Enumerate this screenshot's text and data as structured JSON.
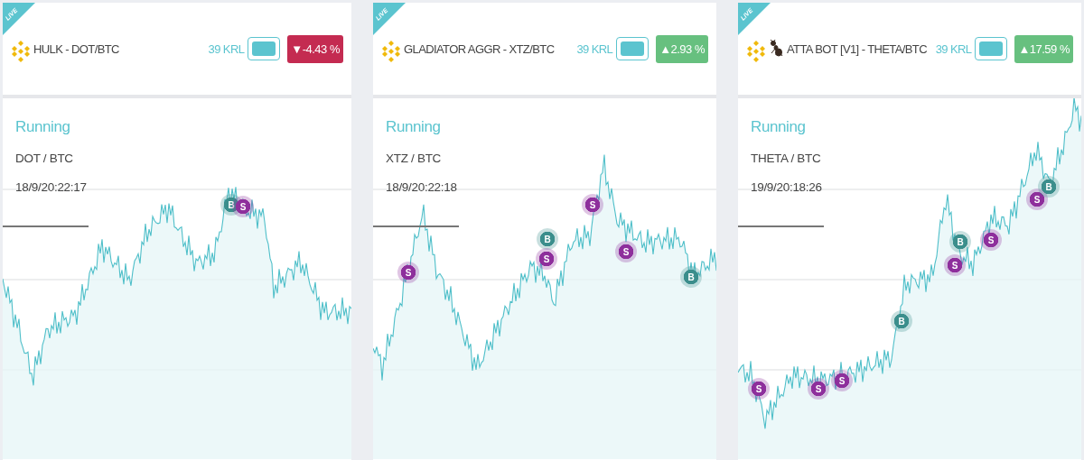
{
  "cards": [
    {
      "ribbon": "LIVE",
      "mascot": false,
      "title": "HULK - DOT/BTC",
      "price": "39 KRL",
      "toggle": {
        "on": true
      },
      "change": {
        "negative": true,
        "arrow": "▼",
        "value": "-4.43 %"
      },
      "status": "Running",
      "pair": "DOT / BTC",
      "started": "18/9/20:22:17",
      "markers": [
        {
          "kind": "buy",
          "label": "B"
        },
        {
          "kind": "sell",
          "label": "S"
        }
      ]
    },
    {
      "ribbon": "LIVE",
      "mascot": false,
      "title": "GLADIATOR AGGR - XTZ/BTC",
      "price": "39 KRL",
      "toggle": {
        "on": true
      },
      "change": {
        "negative": false,
        "arrow": "▲",
        "value": "2.93 %"
      },
      "status": "Running",
      "pair": "XTZ / BTC",
      "started": "18/9/20:22:18",
      "markers": [
        {
          "kind": "sell",
          "label": "S"
        },
        {
          "kind": "buy",
          "label": "B"
        },
        {
          "kind": "sell",
          "label": "S"
        },
        {
          "kind": "sell",
          "label": "S"
        },
        {
          "kind": "sell",
          "label": "S"
        },
        {
          "kind": "buy",
          "label": "B"
        }
      ]
    },
    {
      "ribbon": "LIVE",
      "mascot": true,
      "title": "ATTA BOT [V1] - THETA/BTC",
      "price": "39 KRL",
      "toggle": {
        "on": true
      },
      "change": {
        "negative": false,
        "arrow": "▲",
        "value": "17.59 %"
      },
      "status": "Running",
      "pair": "THETA / BTC",
      "started": "19/9/20:18:26",
      "markers": [
        {
          "kind": "sell",
          "label": "S"
        },
        {
          "kind": "sell",
          "label": "S"
        },
        {
          "kind": "sell",
          "label": "S"
        },
        {
          "kind": "buy",
          "label": "B"
        },
        {
          "kind": "sell",
          "label": "S"
        },
        {
          "kind": "buy",
          "label": "B"
        },
        {
          "kind": "sell",
          "label": "S"
        },
        {
          "kind": "sell",
          "label": "S"
        },
        {
          "kind": "buy",
          "label": "B"
        }
      ]
    }
  ]
}
